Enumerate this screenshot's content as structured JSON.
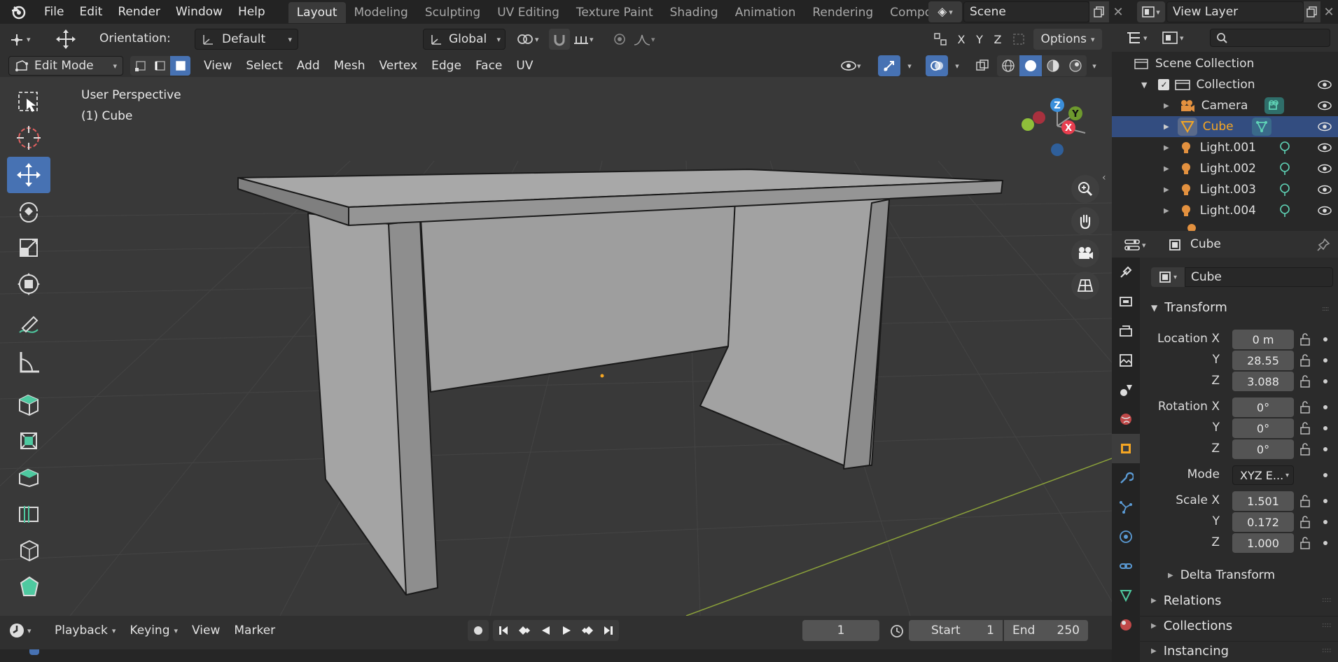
{
  "menubar": {
    "items": [
      "File",
      "Edit",
      "Render",
      "Window",
      "Help"
    ],
    "workspaces": [
      "Layout",
      "Modeling",
      "Sculpting",
      "UV Editing",
      "Texture Paint",
      "Shading",
      "Animation",
      "Rendering",
      "Compos"
    ],
    "active_workspace": "Layout",
    "scene": "Scene",
    "view_layer": "View Layer"
  },
  "viewport_header": {
    "orientation_label": "Orientation:",
    "orientation_value": "Default",
    "transform_orientation": "Global",
    "axes": [
      "X",
      "Y",
      "Z"
    ],
    "options_label": "Options",
    "mode": "Edit Mode",
    "menus": [
      "View",
      "Select",
      "Add",
      "Mesh",
      "Vertex",
      "Edge",
      "Face",
      "UV"
    ]
  },
  "viewport": {
    "view_name": "User Perspective",
    "object_info": "(1) Cube",
    "gizmo_axes": {
      "x": "X",
      "y": "Y",
      "z": "Z"
    }
  },
  "toolbar": {
    "tools": [
      "select-box",
      "cursor",
      "move",
      "rotate",
      "scale",
      "transform",
      "annotate",
      "measure",
      "add-cube",
      "extrude-region",
      "inset-faces",
      "bevel",
      "loop-cut",
      "knife",
      "poly-build"
    ],
    "active_tool": "move"
  },
  "timeline": {
    "menus": [
      "Playback",
      "Keying",
      "View",
      "Marker"
    ],
    "current_frame": "1",
    "start_label": "Start",
    "start_value": "1",
    "end_label": "End",
    "end_value": "250"
  },
  "outliner": {
    "root": "Scene Collection",
    "collection": "Collection",
    "items": [
      {
        "name": "Camera",
        "type": "camera",
        "selected": false
      },
      {
        "name": "Cube",
        "type": "mesh",
        "selected": true
      },
      {
        "name": "Light.001",
        "type": "light",
        "selected": false
      },
      {
        "name": "Light.002",
        "type": "light",
        "selected": false
      },
      {
        "name": "Light.003",
        "type": "light",
        "selected": false
      },
      {
        "name": "Light.004",
        "type": "light",
        "selected": false
      }
    ]
  },
  "properties": {
    "context_name": "Cube",
    "object_name": "Cube",
    "transform_header": "Transform",
    "location_label": "Location X",
    "location": {
      "x": "0 m",
      "y": "28.55",
      "z": "3.088"
    },
    "rotation_label": "Rotation X",
    "rotation": {
      "x": "0°",
      "y": "0°",
      "z": "0°"
    },
    "mode_label": "Mode",
    "mode_value": "XYZ E...",
    "scale_label": "Scale X",
    "scale": {
      "x": "1.501",
      "y": "0.172",
      "z": "1.000"
    },
    "axis_y": "Y",
    "axis_z": "Z",
    "delta_transform": "Delta Transform",
    "panels": [
      "Relations",
      "Collections",
      "Instancing"
    ]
  },
  "colors": {
    "accent": "#4772b3",
    "selected_object": "#f5a623",
    "x_axis": "#e83e4f",
    "y_axis": "#7ab33b",
    "z_axis": "#3b8fdb"
  }
}
